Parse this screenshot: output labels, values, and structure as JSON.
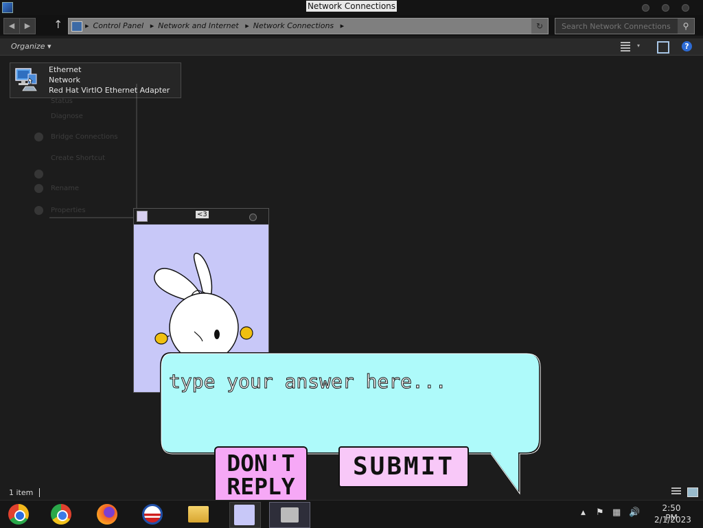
{
  "window": {
    "title": "Network Connections"
  },
  "address": {
    "crumbs": [
      "Control Panel",
      "Network and Internet",
      "Network Connections"
    ]
  },
  "search": {
    "placeholder": "Search Network Connections"
  },
  "toolbar": {
    "organize_label": "Organize"
  },
  "item": {
    "name": "Ethernet",
    "network": "Network",
    "adapter": "Red Hat VirtIO Ethernet Adapter"
  },
  "context_menu": [
    "Status",
    "Diagnose",
    "Bridge Connections",
    "Create Shortcut",
    "Rename",
    "Properties"
  ],
  "bunny_window": {
    "title": "<3"
  },
  "bubble": {
    "placeholder": "type your answer here...",
    "dont_reply_line1": "DON'T",
    "dont_reply_line2": "REPLY",
    "submit_label": "SUBMIT"
  },
  "status_bar": {
    "item_count": "1 item"
  },
  "taskbar": {
    "apps": [
      "chrome-canary-icon",
      "chrome-icon",
      "firefox-icon",
      "obama-logo-icon",
      "file-explorer-icon",
      "bunny-app-icon",
      "control-panel-icon"
    ],
    "time": "2:50 PM",
    "date": "2/1/2023"
  }
}
